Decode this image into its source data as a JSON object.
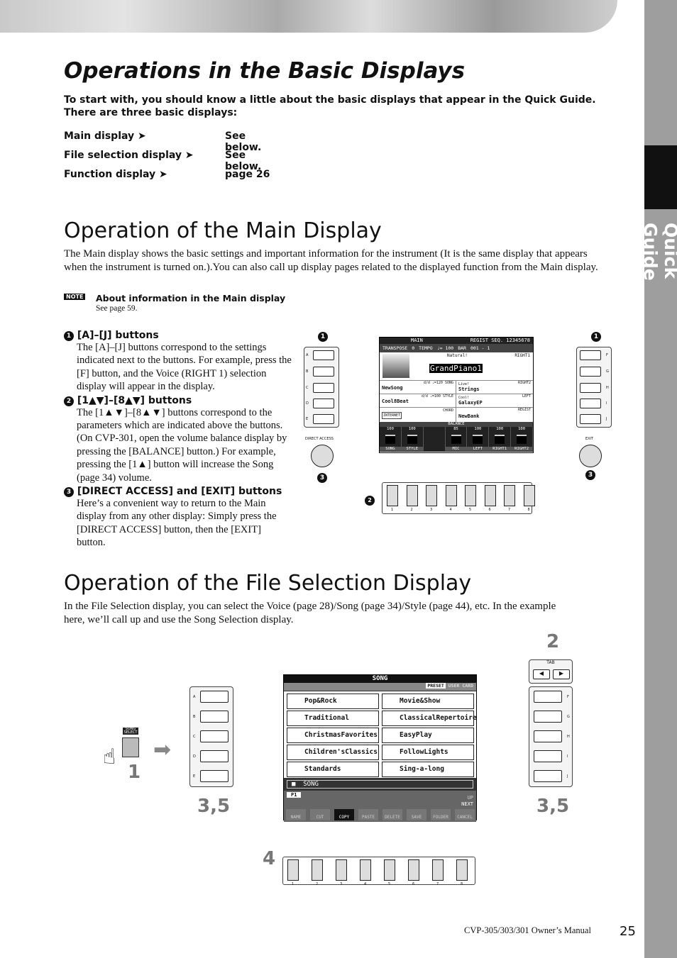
{
  "sidebar": {
    "section": "Quick Guide"
  },
  "section1": {
    "title": "Operations in the Basic Displays",
    "intro": "To start with, you should know a little about the basic displays that appear in the Quick Guide. There are three basic displays:",
    "rows": [
      {
        "label": "Main display ➤",
        "ref": "See below."
      },
      {
        "label": "File selection display ➤",
        "ref": "See below."
      },
      {
        "label": "Function display ➤",
        "ref": "page 26"
      }
    ]
  },
  "section2": {
    "title": "Operation of the Main Display",
    "body": "The Main display shows the basic settings and important information for the instrument (It is the same display that appears when the instrument is turned on.).You can also call up display pages related to the displayed function from the Main display.",
    "note": {
      "badge": "NOTE",
      "title": "About information in the Main display",
      "text": "See page 59."
    },
    "items": [
      {
        "num": "1",
        "heading": "[A]–[J] buttons",
        "text": "The [A]–[J] buttons correspond to the settings indicated next to the buttons. For example, press the [F] button, and the Voice (RIGHT 1) selection display will appear in the display."
      },
      {
        "num": "2",
        "heading": "[1▲▼]–[8▲▼] buttons",
        "text": "The [1▲▼]–[8▲▼] buttons correspond to the parameters which are indicated above the buttons. (On CVP-301, open the volume balance display by pressing the [BALANCE] button.) For example, pressing the [1▲] button will increase the Song (page 34) volume."
      },
      {
        "num": "3",
        "heading": "[DIRECT ACCESS] and [EXIT] buttons",
        "text": "Here’s a convenient way to return to the Main display from any other display: Simply press the [DIRECT ACCESS] button, then the [EXIT] button."
      }
    ],
    "figure": {
      "left_letters": [
        "A",
        "B",
        "C",
        "D",
        "E"
      ],
      "right_letters": [
        "F",
        "G",
        "H",
        "I",
        "J"
      ],
      "direct_access": "DIRECT ACCESS",
      "exit": "EXIT",
      "callouts": [
        "1",
        "1",
        "2",
        "3",
        "3"
      ],
      "slider_nums": [
        "1",
        "2",
        "3",
        "4",
        "5",
        "6",
        "7",
        "8"
      ],
      "lcd": {
        "title": "MAIN",
        "regist": "REGIST SEQ. 12345678",
        "transpose_label": "TRANSPOSE",
        "transpose": "0",
        "tempo_label": "TEMPO",
        "tempo": "♩= 100",
        "bar_label": "BAR",
        "bar": "001 - 1",
        "voice_cat": "Natural!",
        "part": "RIGHT1",
        "voice": "GrandPiano1",
        "song_info": "d/d  ♩=120  SONG",
        "song": "NewSong",
        "style_info": "d/d  ♩=100 STYLE",
        "style": "Cool8Beat",
        "internet": "INTERNET",
        "chord": "CHORD",
        "r2_cat": "Live!",
        "r2_part": "RIGHT2",
        "r2": "Strings",
        "left_cat": "Cool!",
        "left_part": "LEFT",
        "left": "GalaxyEP",
        "regist_label": "REGIST",
        "bank": "NewBank",
        "balance": "BALANCE",
        "bal_values": [
          "100",
          "100",
          "",
          "85",
          "100",
          "100",
          "100"
        ],
        "bal_labels": [
          "SONG",
          "STYLE",
          "",
          "MIC",
          "LEFT",
          "RIGHT1",
          "RIGHT2"
        ]
      }
    }
  },
  "section3": {
    "title": "Operation of the File Selection Display",
    "body": "In the File Selection display, you can select the Voice (page 28)/Song (page 34)/Style (page 44), etc. In the example here, we’ll call up and use the Song Selection display.",
    "figure": {
      "song_select": "SONG SELECT",
      "tab": "TAB",
      "steps": {
        "s1": "1",
        "s2": "2",
        "s35a": "3,5",
        "s35b": "3,5",
        "s4": "4"
      },
      "left_letters": [
        "A",
        "B",
        "C",
        "D",
        "E"
      ],
      "right_letters": [
        "F",
        "G",
        "H",
        "I",
        "J"
      ],
      "slider_nums": [
        "1",
        "2",
        "3",
        "4",
        "5",
        "6",
        "7",
        "8"
      ],
      "lcd": {
        "title": "SONG",
        "tabs": [
          "PRESET",
          "USER",
          "CARD"
        ],
        "files_left": [
          "Pop&Rock",
          "Traditional",
          "ChristmasFavorites",
          "Children'sClassics",
          "Standards"
        ],
        "files_right": [
          "Movie&Show",
          "ClassicalRepertoire",
          "EasyPlay",
          "FollowLights",
          "Sing-a-long"
        ],
        "folder": "SONG",
        "page": "P1",
        "up": "UP",
        "next": "NEXT",
        "tools": [
          "NAME",
          "CUT",
          "COPY",
          "PASTE",
          "DELETE",
          "SAVE",
          "FOLDER",
          "CANCEL"
        ]
      }
    }
  },
  "footer": {
    "manual": "CVP-305/303/301 Owner’s Manual",
    "page": "25"
  }
}
